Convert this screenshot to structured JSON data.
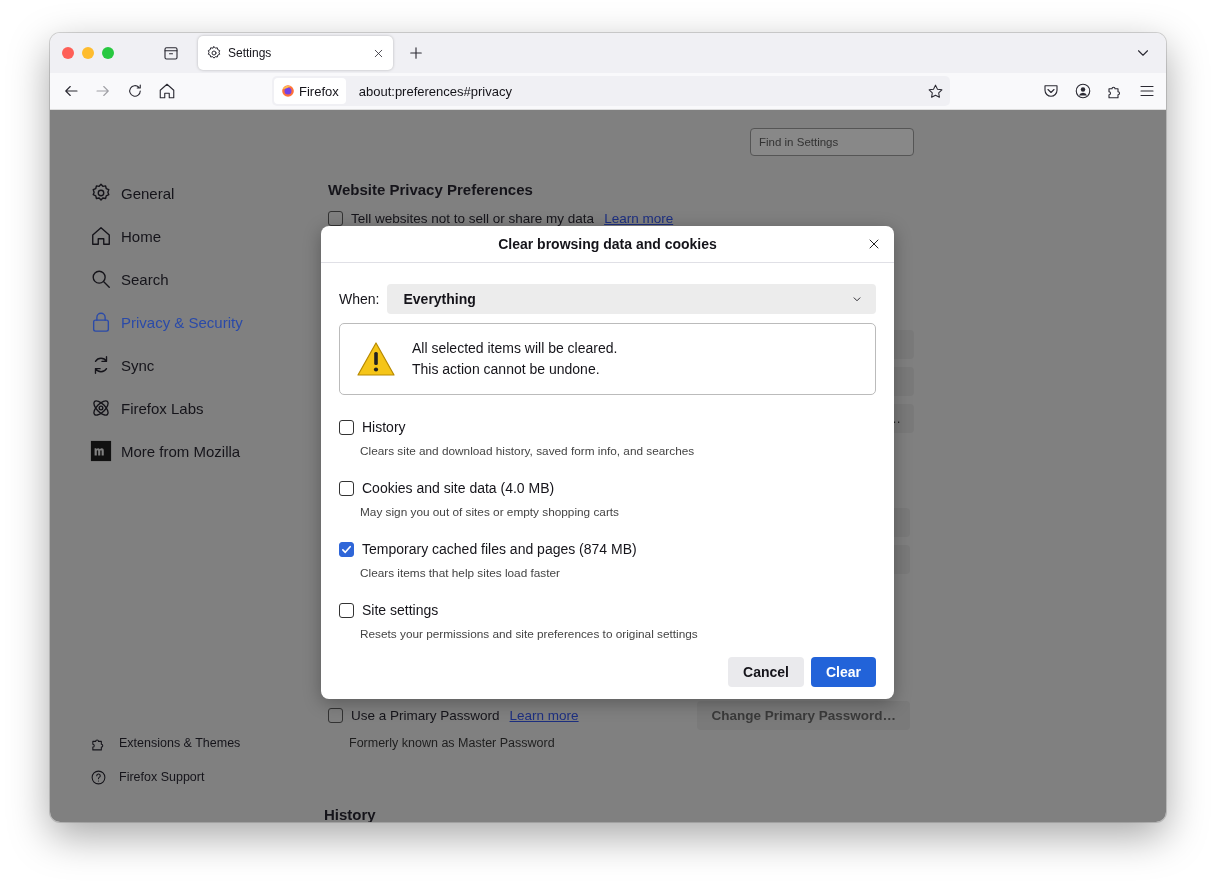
{
  "tabs": [
    {
      "label": "Settings",
      "selected": true
    }
  ],
  "toolbar": {
    "identity": "Firefox",
    "url": "about:preferences#privacy"
  },
  "settings_search": {
    "placeholder": "Find in Settings"
  },
  "sidebar": {
    "items": [
      {
        "label": "General",
        "selected": false
      },
      {
        "label": "Home",
        "selected": false
      },
      {
        "label": "Search",
        "selected": false
      },
      {
        "label": "Privacy & Security",
        "selected": true
      },
      {
        "label": "Sync",
        "selected": false
      },
      {
        "label": "Firefox Labs",
        "selected": false
      },
      {
        "label": "More from Mozilla",
        "selected": false
      }
    ],
    "footer": [
      {
        "label": "Extensions & Themes"
      },
      {
        "label": "Firefox Support"
      }
    ]
  },
  "page": {
    "heading": "Website Privacy Preferences",
    "option": {
      "label": "Tell websites not to sell or share my data",
      "checked": false,
      "link": "Learn more"
    },
    "partial_buttons": [
      {
        "kind": "blank"
      },
      {
        "kind": "blank"
      },
      {
        "kind": "text",
        "label": "…"
      },
      {
        "kind": "gap"
      },
      {
        "kind": "blank"
      },
      {
        "kind": "blank"
      }
    ],
    "primary_password": {
      "label": "Use a Primary Password",
      "checked": false,
      "link": "Learn more",
      "note": "Formerly known as Master Password",
      "button": "Change Primary Password…",
      "disabled": true
    },
    "next_heading": "History"
  },
  "dialog": {
    "title": "Clear browsing data and cookies",
    "when_label": "When:",
    "when_value": "Everything",
    "warning": [
      "All selected items will be cleared.",
      "This action cannot be undone."
    ],
    "options": [
      {
        "label": "History",
        "description": "Clears site and download history, saved form info, and searches",
        "checked": false
      },
      {
        "label": "Cookies and site data (4.0 MB)",
        "description": "May sign you out of sites or empty shopping carts",
        "checked": false
      },
      {
        "label": "Temporary cached files and pages (874 MB)",
        "description": "Clears items that help sites load faster",
        "checked": true
      },
      {
        "label": "Site settings",
        "description": "Resets your permissions and site preferences to original settings",
        "checked": false
      }
    ],
    "buttons": [
      {
        "label": "Cancel",
        "kind": "secondary"
      },
      {
        "label": "Clear",
        "kind": "primary"
      }
    ]
  }
}
